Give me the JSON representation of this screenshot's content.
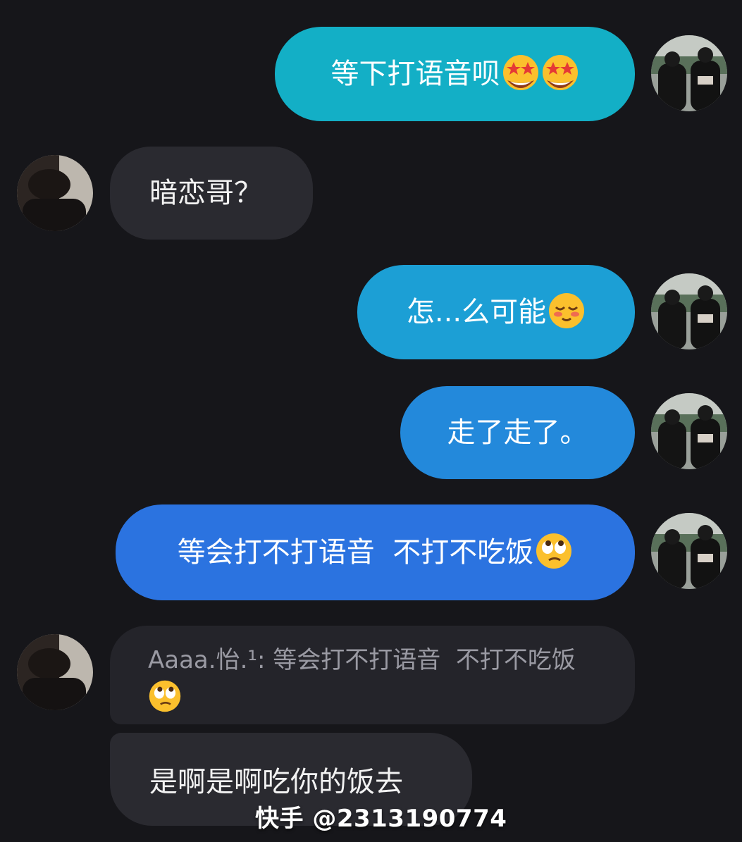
{
  "colors": {
    "background": "#16161a",
    "incoming_bubble": "#2a2a30",
    "quote_bubble": "#24242a",
    "outgoing_gradient": [
      "#12b3c7",
      "#1e9ed6",
      "#2586dc",
      "#2b72e0"
    ]
  },
  "messages": [
    {
      "id": "m1",
      "side": "out",
      "text": "等下打语音呗",
      "emojis": [
        "star-struck-emoji",
        "star-struck-emoji"
      ]
    },
    {
      "id": "m2",
      "side": "in",
      "text": "暗恋哥？",
      "emojis": []
    },
    {
      "id": "m3",
      "side": "out",
      "text": "怎...么可能",
      "emojis": [
        "relieved-blush-emoji"
      ]
    },
    {
      "id": "m4",
      "side": "out",
      "text": "走了走了。",
      "emojis": []
    },
    {
      "id": "m5",
      "side": "out",
      "text": "等会打不打语音  不打不吃饭",
      "emojis": [
        "eye-roll-emoji"
      ]
    }
  ],
  "quote": {
    "text": "Aaaa.怡.¹: 等会打不打语音  不打不吃饭",
    "emoji": "eye-roll-emoji"
  },
  "reply": {
    "text": "是啊是啊吃你的饭去"
  },
  "watermark": {
    "text": "快手 @2313190774"
  }
}
